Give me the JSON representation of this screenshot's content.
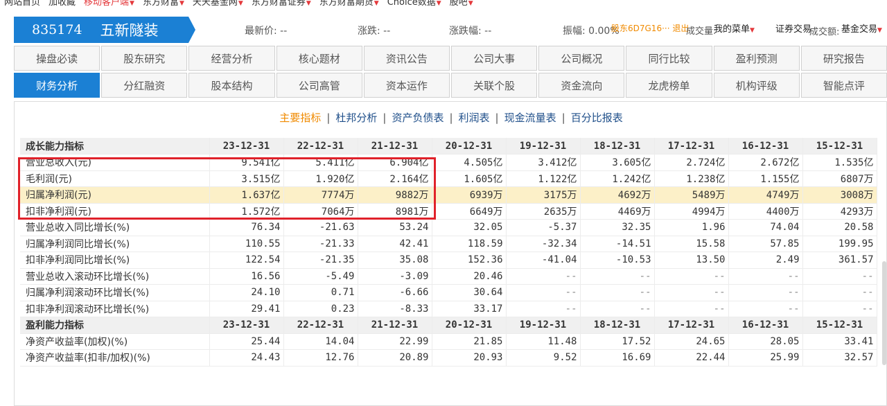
{
  "topnav": [
    {
      "label": "网站首页",
      "red": false,
      "caret": false
    },
    {
      "label": "加收藏",
      "red": false,
      "caret": false
    },
    {
      "label": "移动客户端",
      "red": true,
      "caret": true
    },
    {
      "label": "东方财富",
      "red": false,
      "caret": true
    },
    {
      "label": "天天基金网",
      "red": false,
      "caret": true
    },
    {
      "label": "东方财富证券",
      "red": false,
      "caret": true
    },
    {
      "label": "东方财富期货",
      "red": false,
      "caret": true
    },
    {
      "label": "Choice数据",
      "red": false,
      "caret": true
    },
    {
      "label": "股吧",
      "red": false,
      "caret": true
    }
  ],
  "stock": {
    "code": "835174",
    "name": "五新隧装"
  },
  "quote": {
    "latest_label": "最新价:",
    "latest_value": "--",
    "change_label": "涨跌:",
    "change_value": "--",
    "pct_label": "涨跌幅:",
    "pct_value": "--",
    "amp_label": "振幅:",
    "amp_value": "0.00%",
    "overlay1": "股东6D7G16··· 退出",
    "overlay2": "成交量:",
    "overlay3": "我的菜单",
    "overlay4": "证券交易",
    "overlay5": "成交额:",
    "overlay6": "基金交易"
  },
  "nav": {
    "row1": [
      "操盘必读",
      "股东研究",
      "经营分析",
      "核心题材",
      "资讯公告",
      "公司大事",
      "公司概况",
      "同行比较",
      "盈利预测",
      "研究报告"
    ],
    "row2": [
      "财务分析",
      "分红融资",
      "股本结构",
      "公司高管",
      "资本运作",
      "关联个股",
      "资金流向",
      "龙虎榜单",
      "机构评级",
      "智能点评"
    ],
    "active": "财务分析"
  },
  "subtabs": [
    "主要指标",
    "杜邦分析",
    "资产负债表",
    "利润表",
    "现金流量表",
    "百分比报表"
  ],
  "subtab_active": "主要指标",
  "table": {
    "rows": [
      {
        "type": "head",
        "label": "成长能力指标",
        "values": [
          "23-12-31",
          "22-12-31",
          "21-12-31",
          "20-12-31",
          "19-12-31",
          "18-12-31",
          "17-12-31",
          "16-12-31",
          "15-12-31"
        ]
      },
      {
        "type": "row",
        "label": "营业总收入(元)",
        "values": [
          "9.541亿",
          "5.411亿",
          "6.904亿",
          "4.505亿",
          "3.412亿",
          "3.605亿",
          "2.724亿",
          "2.672亿",
          "1.535亿"
        ]
      },
      {
        "type": "row",
        "label": "毛利润(元)",
        "values": [
          "3.515亿",
          "1.920亿",
          "2.164亿",
          "1.605亿",
          "1.122亿",
          "1.242亿",
          "1.238亿",
          "1.155亿",
          "6807万"
        ]
      },
      {
        "type": "hl",
        "label": "归属净利润(元)",
        "values": [
          "1.637亿",
          "7774万",
          "9882万",
          "6939万",
          "3175万",
          "4692万",
          "5489万",
          "4749万",
          "3008万"
        ]
      },
      {
        "type": "row",
        "label": "扣非净利润(元)",
        "values": [
          "1.572亿",
          "7064万",
          "8981万",
          "6649万",
          "2635万",
          "4469万",
          "4994万",
          "4400万",
          "4293万"
        ]
      },
      {
        "type": "row",
        "label": "营业总收入同比增长(%)",
        "values": [
          "76.34",
          "-21.63",
          "53.24",
          "32.05",
          "-5.37",
          "32.35",
          "1.96",
          "74.04",
          "20.58"
        ]
      },
      {
        "type": "row",
        "label": "归属净利润同比增长(%)",
        "values": [
          "110.55",
          "-21.33",
          "42.41",
          "118.59",
          "-32.34",
          "-14.51",
          "15.58",
          "57.85",
          "199.95"
        ]
      },
      {
        "type": "row",
        "label": "扣非净利润同比增长(%)",
        "values": [
          "122.54",
          "-21.35",
          "35.08",
          "152.36",
          "-41.04",
          "-10.53",
          "13.50",
          "2.49",
          "361.57"
        ]
      },
      {
        "type": "row",
        "label": "营业总收入滚动环比增长(%)",
        "values": [
          "16.56",
          "-5.49",
          "-3.09",
          "20.46",
          "--",
          "--",
          "--",
          "--",
          "--"
        ]
      },
      {
        "type": "row",
        "label": "归属净利润滚动环比增长(%)",
        "values": [
          "24.10",
          "0.71",
          "-6.66",
          "30.64",
          "--",
          "--",
          "--",
          "--",
          "--"
        ]
      },
      {
        "type": "row",
        "label": "扣非净利润滚动环比增长(%)",
        "values": [
          "29.41",
          "0.23",
          "-8.33",
          "33.17",
          "--",
          "--",
          "--",
          "--",
          "--"
        ]
      },
      {
        "type": "head",
        "label": "盈利能力指标",
        "values": [
          "23-12-31",
          "22-12-31",
          "21-12-31",
          "20-12-31",
          "19-12-31",
          "18-12-31",
          "17-12-31",
          "16-12-31",
          "15-12-31"
        ]
      },
      {
        "type": "row",
        "label": "净资产收益率(加权)(%)",
        "values": [
          "25.44",
          "14.04",
          "22.99",
          "21.85",
          "11.48",
          "17.52",
          "24.65",
          "28.05",
          "33.41"
        ]
      },
      {
        "type": "row",
        "label": "净资产收益率(扣非/加权)(%)",
        "values": [
          "24.43",
          "12.76",
          "20.89",
          "20.93",
          "9.52",
          "16.69",
          "22.44",
          "25.99",
          "32.57"
        ]
      }
    ]
  }
}
